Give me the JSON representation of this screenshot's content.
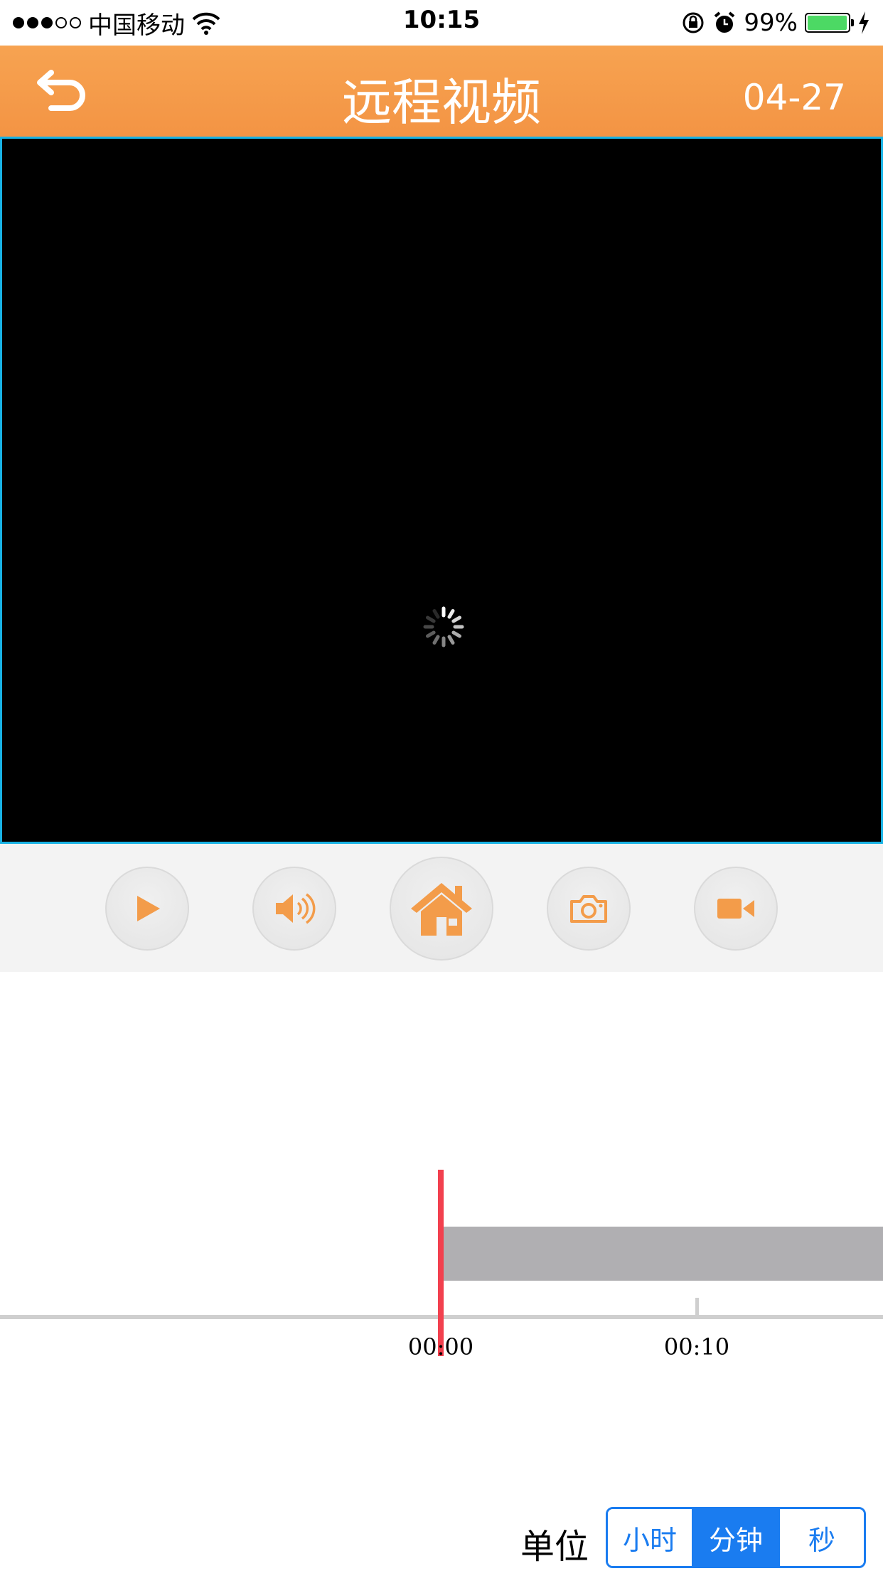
{
  "status_bar": {
    "carrier": "中国移动",
    "time": "10:15",
    "battery_percent": "99%",
    "signal_strength": 3,
    "signal_max": 5
  },
  "nav": {
    "title": "远程视频",
    "date": "04-27",
    "back_icon": "back-arrow-icon"
  },
  "video": {
    "state": "loading"
  },
  "controls": [
    {
      "icon": "play-icon"
    },
    {
      "icon": "speaker-icon"
    },
    {
      "icon": "home-icon"
    },
    {
      "icon": "camera-icon"
    },
    {
      "icon": "video-record-icon"
    }
  ],
  "timeline": {
    "labels": [
      "00:00",
      "00:10"
    ]
  },
  "unit": {
    "label": "单位",
    "options": [
      "小时",
      "分钟",
      "秒"
    ],
    "selected": "分钟"
  },
  "colors": {
    "accent": "#f39c4a",
    "cursor": "#f2404e",
    "segment": "#1a7cf0",
    "video_border": "#18b2e4"
  }
}
